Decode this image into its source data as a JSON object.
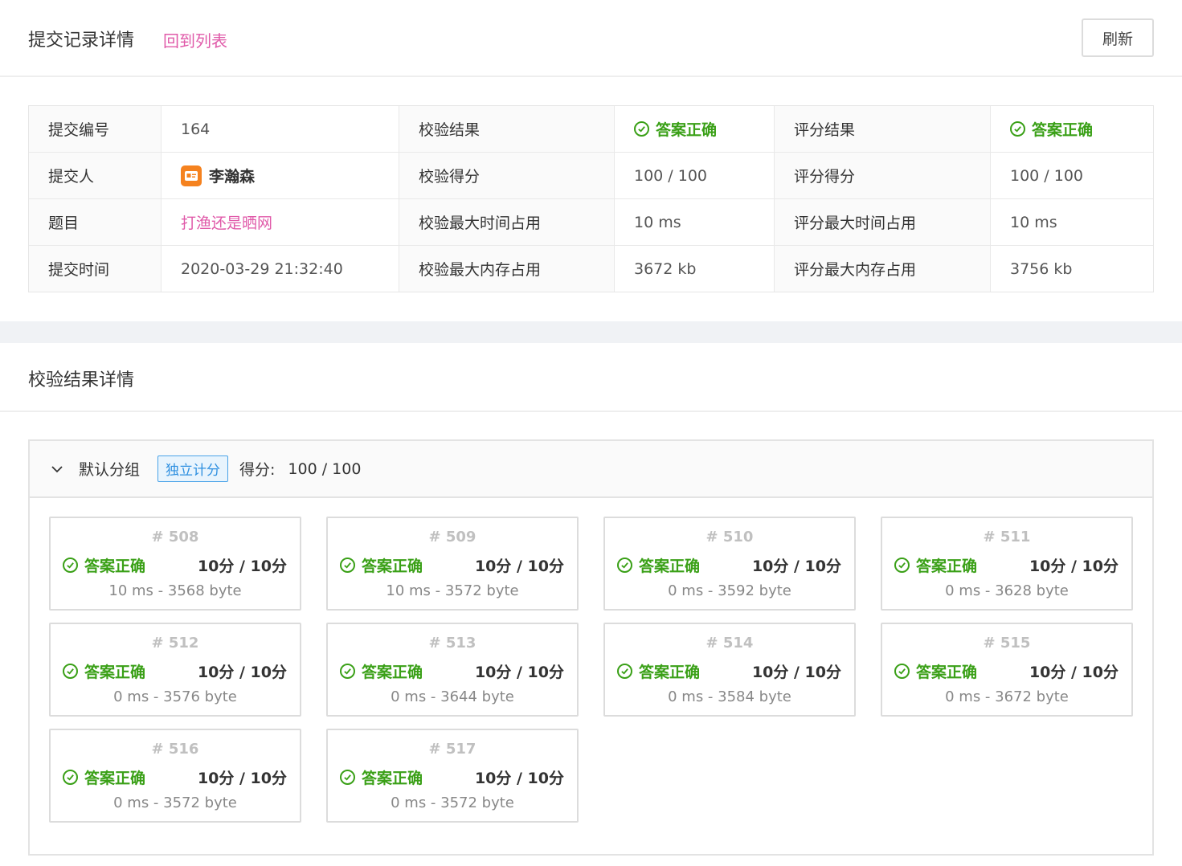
{
  "header": {
    "title": "提交记录详情",
    "back_link": "回到列表",
    "refresh_label": "刷新"
  },
  "colors": {
    "success": "#3aa017",
    "link": "#e05aa9",
    "tag": "#2d8fe0"
  },
  "info": {
    "rows": [
      {
        "l1": "提交编号",
        "v1": "164",
        "l2": "校验结果",
        "v2": "答案正确",
        "l3": "评分结果",
        "v3": "答案正确"
      },
      {
        "l1": "提交人",
        "v1": "李瀚森",
        "l2": "校验得分",
        "v2": "100 / 100",
        "l3": "评分得分",
        "v3": "100 / 100"
      },
      {
        "l1": "题目",
        "v1": "打渔还是晒网",
        "l2": "校验最大时间占用",
        "v2": "10 ms",
        "l3": "评分最大时间占用",
        "v3": "10 ms"
      },
      {
        "l1": "提交时间",
        "v1": "2020-03-29 21:32:40",
        "l2": "校验最大内存占用",
        "v2": "3672 kb",
        "l3": "评分最大内存占用",
        "v3": "3756 kb"
      }
    ]
  },
  "detail": {
    "title": "校验结果详情",
    "group": {
      "name": "默认分组",
      "tag": "独立计分",
      "score_label": "得分:",
      "score": "100 / 100"
    },
    "cases": [
      {
        "id": "# 508",
        "status": "答案正确",
        "score": "10分 / 10分",
        "meta": "10 ms - 3568 byte"
      },
      {
        "id": "# 509",
        "status": "答案正确",
        "score": "10分 / 10分",
        "meta": "10 ms - 3572 byte"
      },
      {
        "id": "# 510",
        "status": "答案正确",
        "score": "10分 / 10分",
        "meta": "0 ms - 3592 byte"
      },
      {
        "id": "# 511",
        "status": "答案正确",
        "score": "10分 / 10分",
        "meta": "0 ms - 3628 byte"
      },
      {
        "id": "# 512",
        "status": "答案正确",
        "score": "10分 / 10分",
        "meta": "0 ms - 3576 byte"
      },
      {
        "id": "# 513",
        "status": "答案正确",
        "score": "10分 / 10分",
        "meta": "0 ms - 3644 byte"
      },
      {
        "id": "# 514",
        "status": "答案正确",
        "score": "10分 / 10分",
        "meta": "0 ms - 3584 byte"
      },
      {
        "id": "# 515",
        "status": "答案正确",
        "score": "10分 / 10分",
        "meta": "0 ms - 3672 byte"
      },
      {
        "id": "# 516",
        "status": "答案正确",
        "score": "10分 / 10分",
        "meta": "0 ms - 3572 byte"
      },
      {
        "id": "# 517",
        "status": "答案正确",
        "score": "10分 / 10分",
        "meta": "0 ms - 3572 byte"
      }
    ]
  }
}
